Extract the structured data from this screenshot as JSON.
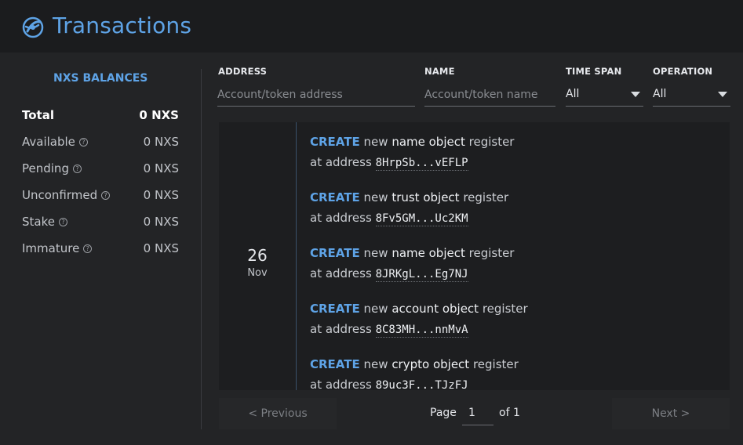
{
  "header": {
    "title": "Transactions"
  },
  "balances": {
    "title": "NXS BALANCES",
    "rows": [
      {
        "label": "Total",
        "value": "0 NXS"
      },
      {
        "label": "Available",
        "value": "0 NXS"
      },
      {
        "label": "Pending",
        "value": "0 NXS"
      },
      {
        "label": "Unconfirmed",
        "value": "0 NXS"
      },
      {
        "label": "Stake",
        "value": "0 NXS"
      },
      {
        "label": "Immature",
        "value": "0 NXS"
      }
    ],
    "help_glyph": "?"
  },
  "filters": {
    "address": {
      "label": "ADDRESS",
      "placeholder": "Account/token address",
      "value": ""
    },
    "name": {
      "label": "NAME",
      "placeholder": "Account/token name",
      "value": ""
    },
    "time_span": {
      "label": "TIME SPAN",
      "value": "All"
    },
    "operation": {
      "label": "OPERATION",
      "value": "All"
    }
  },
  "transactions": {
    "date": {
      "day": "26",
      "month": "Nov"
    },
    "items": [
      {
        "op": "CREATE",
        "pre": "new",
        "object": "name object",
        "post": "register",
        "at": "at address",
        "address": "8HrpSb...vEFLP"
      },
      {
        "op": "CREATE",
        "pre": "new",
        "object": "trust object",
        "post": "register",
        "at": "at address",
        "address": "8Fv5GM...Uc2KM"
      },
      {
        "op": "CREATE",
        "pre": "new",
        "object": "name object",
        "post": "register",
        "at": "at address",
        "address": "8JRKgL...Eg7NJ"
      },
      {
        "op": "CREATE",
        "pre": "new",
        "object": "account object",
        "post": "register",
        "at": "at address",
        "address": "8C83MH...nnMvA"
      },
      {
        "op": "CREATE",
        "pre": "new",
        "object": "crypto object",
        "post": "register",
        "at": "at address",
        "address": "89uc3F...TJzFJ"
      }
    ]
  },
  "pagination": {
    "previous_label": "< Previous",
    "next_label": "Next >",
    "page_label": "Page",
    "current_page": "1",
    "of_label": "of 1"
  },
  "colors": {
    "accent": "#5ea3e6",
    "background": "#232426",
    "header": "#1b1c1e"
  },
  "icons": {
    "logo": "nexus-logo-icon",
    "help": "help-circle-icon",
    "dropdown": "caret-down-icon"
  }
}
